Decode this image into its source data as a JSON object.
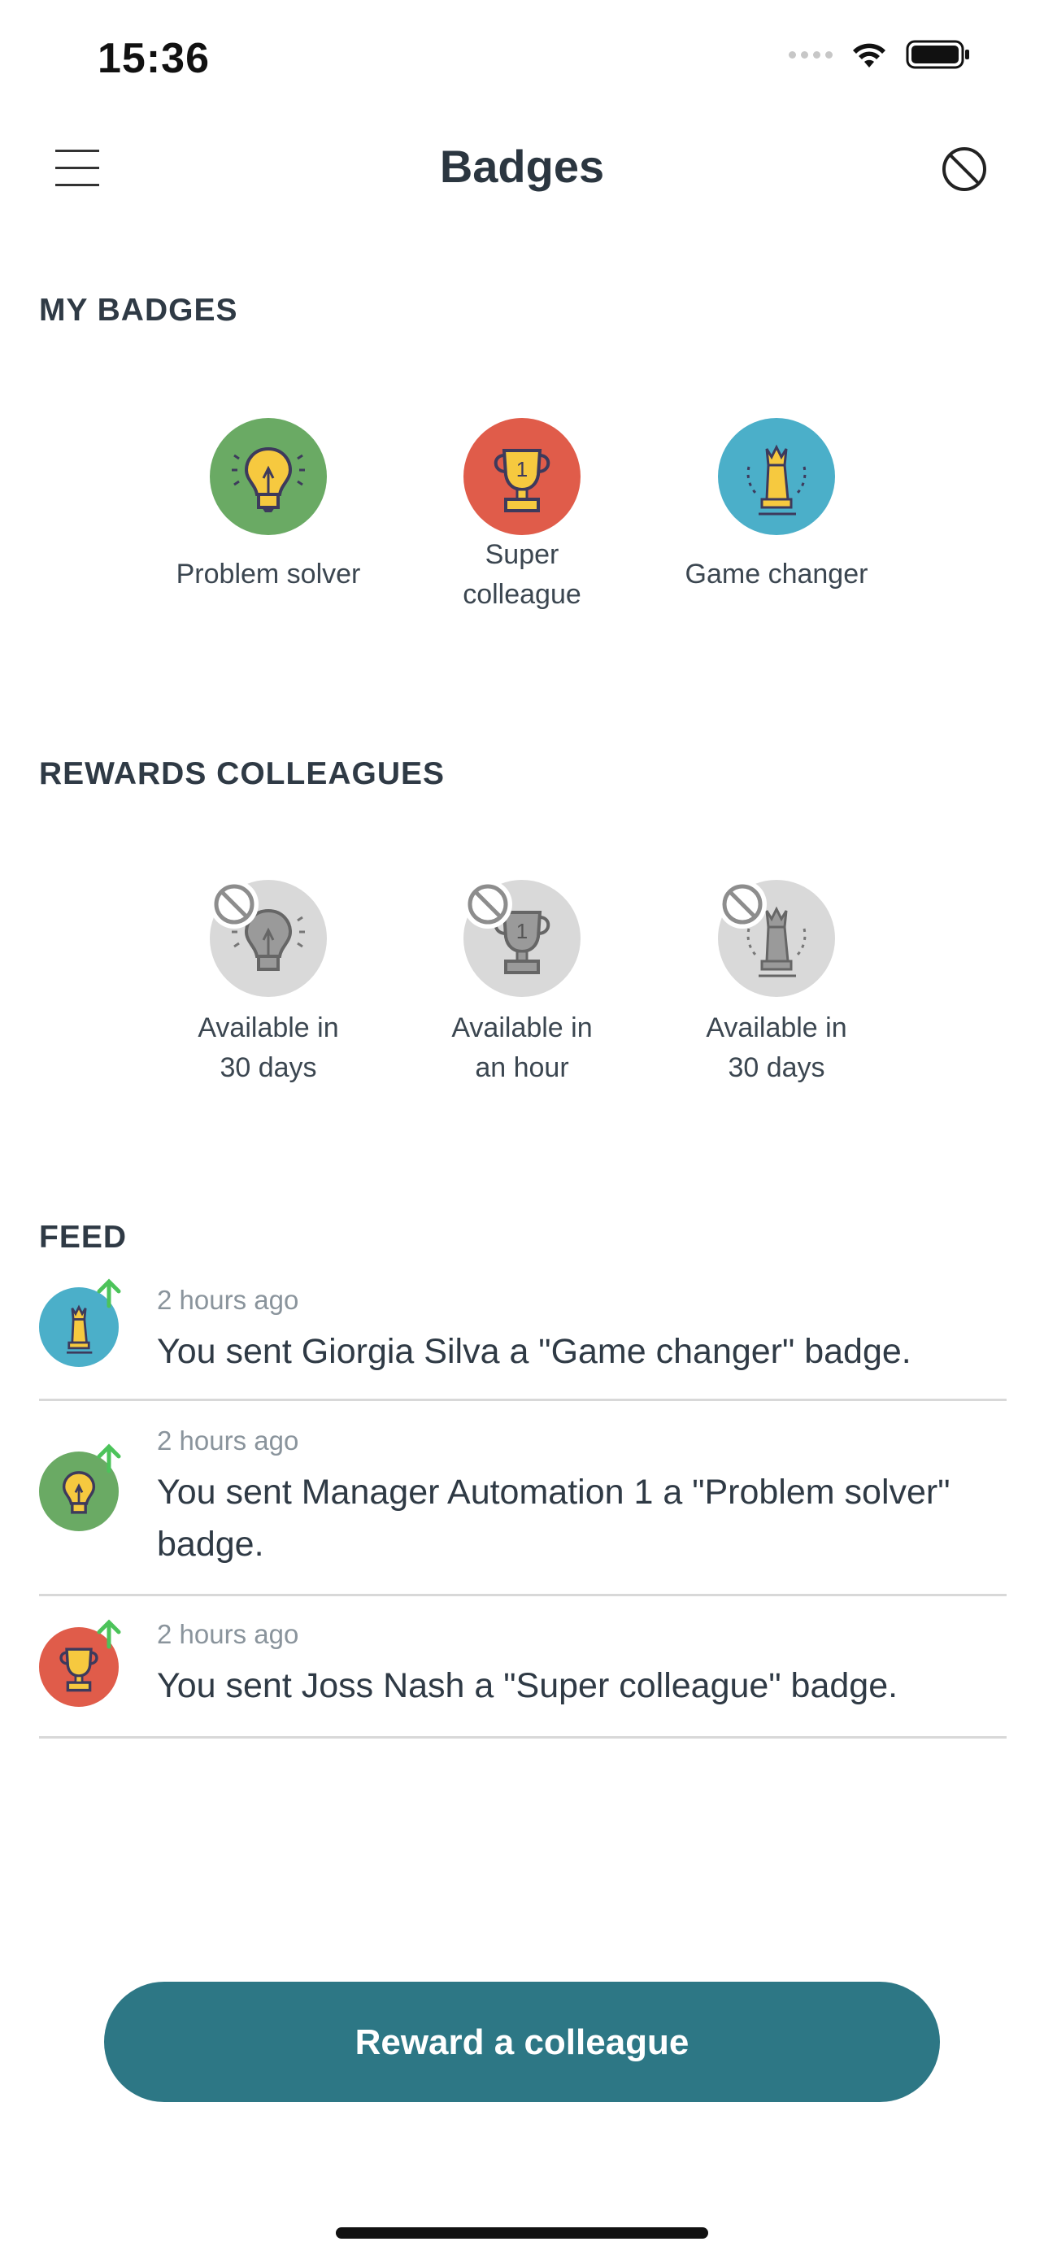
{
  "status_bar": {
    "time": "15:36"
  },
  "header": {
    "title": "Badges"
  },
  "my_badges": {
    "title": "MY BADGES",
    "items": [
      {
        "label": "Problem solver",
        "icon": "lightbulb-icon",
        "color": "#6aaa64"
      },
      {
        "label": "Super\ncolleague",
        "icon": "trophy-icon",
        "color": "#e05c4a"
      },
      {
        "label": "Game changer",
        "icon": "chess-queen-icon",
        "color": "#4bafc9"
      }
    ]
  },
  "rewards": {
    "title": "REWARDS COLLEAGUES",
    "items": [
      {
        "label": "Available in\n30 days",
        "icon": "lightbulb-icon",
        "color": "#d9d9d9"
      },
      {
        "label": "Available in\nan hour",
        "icon": "trophy-icon",
        "color": "#d9d9d9"
      },
      {
        "label": "Available in\n30 days",
        "icon": "chess-queen-icon",
        "color": "#d9d9d9"
      }
    ]
  },
  "feed": {
    "title": "FEED",
    "items": [
      {
        "time": "2 hours ago",
        "text": "You sent Giorgia Silva a \"Game changer\" badge.",
        "icon": "chess-queen-icon",
        "color": "#4bafc9"
      },
      {
        "time": "2 hours ago",
        "text": "You sent Manager Automation 1 a \"Problem solver\" badge.",
        "icon": "lightbulb-icon",
        "color": "#6aaa64"
      },
      {
        "time": "2 hours ago",
        "text": "You sent Joss Nash a \"Super colleague\" badge.",
        "icon": "trophy-icon",
        "color": "#e05c4a"
      }
    ]
  },
  "cta": {
    "label": "Reward a colleague"
  },
  "colors": {
    "accent": "#2d7785",
    "sent_arrow": "#4cc35a"
  }
}
